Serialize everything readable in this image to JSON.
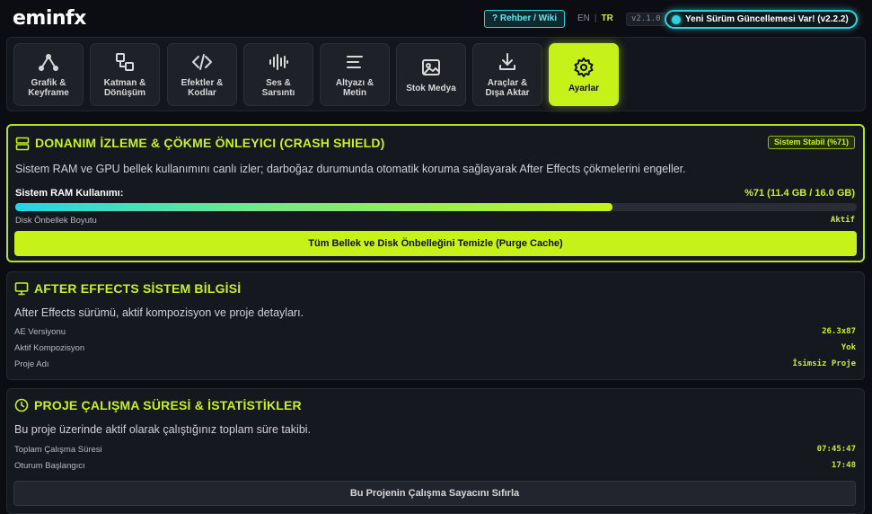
{
  "header": {
    "logo": "eminfx",
    "help_label": "? Rehber / Wiki",
    "lang_en": "EN",
    "lang_sep": "|",
    "lang_tr": "TR",
    "version": "v2.1.0",
    "update_label": "Yeni Sürüm Güncellemesi Var! (v2.2.2)"
  },
  "tabs": [
    {
      "label": "Grafik &\nKeyframe",
      "icon": "graph-curve-icon"
    },
    {
      "label": "Katman &\nDönüşüm",
      "icon": "layers-transform-icon"
    },
    {
      "label": "Efektler &\nKodlar",
      "icon": "code-icon"
    },
    {
      "label": "Ses &\nSarsıntı",
      "icon": "audio-wave-icon"
    },
    {
      "label": "Altyazı &\nMetin",
      "icon": "text-lines-icon"
    },
    {
      "label": "Stok Medya",
      "icon": "image-icon"
    },
    {
      "label": "Araçlar &\nDışa Aktar",
      "icon": "download-icon"
    },
    {
      "label": "Ayarlar",
      "icon": "gear-icon",
      "active": true
    }
  ],
  "crash_shield": {
    "title": "DONANIM İZLEME & ÇÖKME ÖNLEYICI (CRASH SHIELD)",
    "badge": "Sistem Stabil (%71)",
    "description": "Sistem RAM ve GPU bellek kullanımını canlı izler; darboğaz durumunda otomatik koruma sağlayarak After Effects çökmelerini engeller.",
    "ram_label": "Sistem RAM Kullanımı:",
    "ram_value": "%71 (11.4 GB / 16.0 GB)",
    "ram_percent": 71,
    "disk_label": "Disk Önbellek Boyutu",
    "disk_value": "Aktif",
    "purge_button": "Tüm Bellek ve Disk Önbelleğini Temizle (Purge Cache)"
  },
  "ae_info": {
    "title": "AFTER EFFECTS SİSTEM BİLGİSİ",
    "description": "After Effects sürümü, aktif kompozisyon ve proje detayları.",
    "rows": [
      {
        "label": "AE Versiyonu",
        "value": "26.3x87"
      },
      {
        "label": "Aktif Kompozisyon",
        "value": "Yok"
      },
      {
        "label": "Proje Adı",
        "value": "İsimsiz Proje"
      }
    ]
  },
  "stats": {
    "title": "PROJE ÇALIŞMA SÜRESİ & İSTATİSTİKLER",
    "description": "Bu proje üzerinde aktif olarak çalıştığınız toplam süre takibi.",
    "rows": [
      {
        "label": "Toplam Çalışma Süresi",
        "value": "07:45:47"
      },
      {
        "label": "Oturum Başlangıcı",
        "value": "17:48"
      }
    ],
    "reset_button": "Bu Projenin Çalışma Sayacını Sıfırla"
  },
  "colors": {
    "accent": "#c6f21a",
    "cyan": "#2fd3e0",
    "background": "#0c0d12"
  }
}
